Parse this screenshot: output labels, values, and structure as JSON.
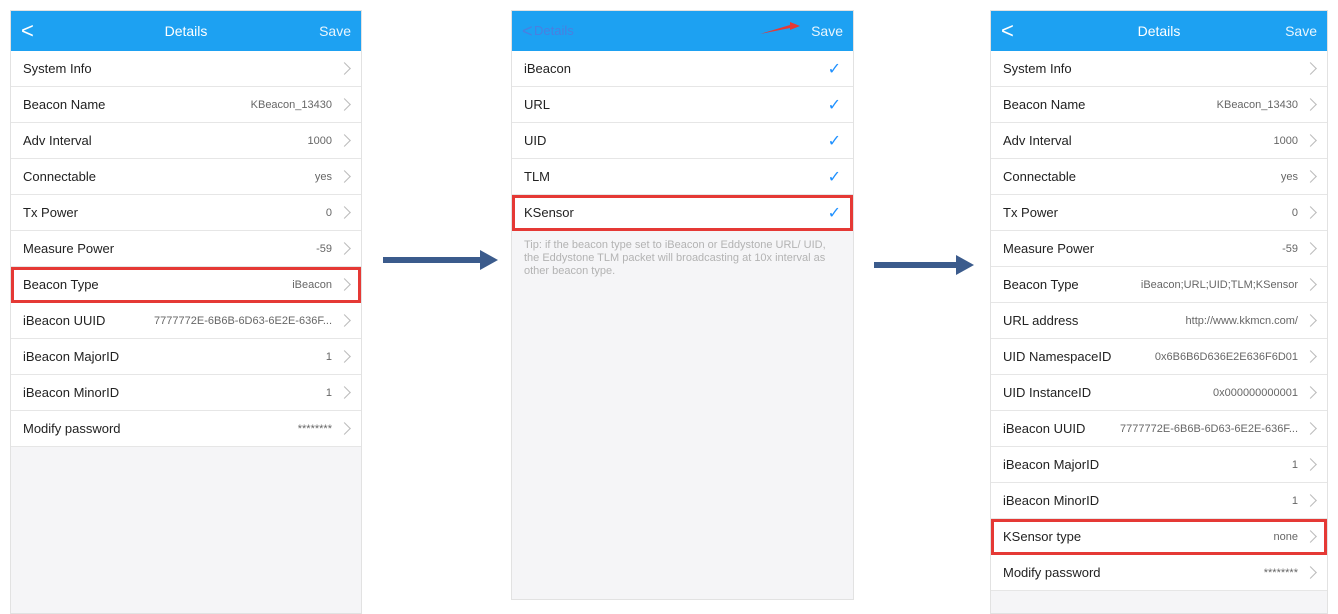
{
  "screen1": {
    "nav": {
      "back": "<",
      "title": "Details",
      "save": "Save"
    },
    "rows": [
      {
        "label": "System Info",
        "value": ""
      },
      {
        "label": "Beacon Name",
        "value": "KBeacon_13430"
      },
      {
        "label": "Adv Interval",
        "value": "1000"
      },
      {
        "label": "Connectable",
        "value": "yes"
      },
      {
        "label": "Tx Power",
        "value": "0"
      },
      {
        "label": "Measure Power",
        "value": "-59"
      },
      {
        "label": "Beacon Type",
        "value": "iBeacon"
      },
      {
        "label": "iBeacon UUID",
        "value": "7777772E-6B6B-6D63-6E2E-636F..."
      },
      {
        "label": "iBeacon MajorID",
        "value": "1"
      },
      {
        "label": "iBeacon MinorID",
        "value": "1"
      },
      {
        "label": "Modify password",
        "value": "********"
      }
    ]
  },
  "screen2": {
    "nav": {
      "back": "<",
      "title": "Details",
      "save": "Save"
    },
    "rows": [
      {
        "label": "iBeacon",
        "check": "✓"
      },
      {
        "label": "URL",
        "check": "✓"
      },
      {
        "label": "UID",
        "check": "✓"
      },
      {
        "label": "TLM",
        "check": "✓"
      },
      {
        "label": "KSensor",
        "check": "✓"
      }
    ],
    "tip": "Tip: if the beacon type set to iBeacon or Eddystone URL/ UID, the Eddystone TLM packet will broadcasting at 10x interval as other beacon type."
  },
  "screen3": {
    "nav": {
      "back": "<",
      "title": "Details",
      "save": "Save"
    },
    "rows": [
      {
        "label": "System Info",
        "value": ""
      },
      {
        "label": "Beacon Name",
        "value": "KBeacon_13430"
      },
      {
        "label": "Adv Interval",
        "value": "1000"
      },
      {
        "label": "Connectable",
        "value": "yes"
      },
      {
        "label": "Tx Power",
        "value": "0"
      },
      {
        "label": "Measure Power",
        "value": "-59"
      },
      {
        "label": "Beacon Type",
        "value": "iBeacon;URL;UID;TLM;KSensor"
      },
      {
        "label": "URL address",
        "value": "http://www.kkmcn.com/"
      },
      {
        "label": "UID NamespaceID",
        "value": "0x6B6B6D636E2E636F6D01"
      },
      {
        "label": "UID InstanceID",
        "value": "0x000000000001"
      },
      {
        "label": "iBeacon UUID",
        "value": "7777772E-6B6B-6D63-6E2E-636F..."
      },
      {
        "label": "iBeacon MajorID",
        "value": "1"
      },
      {
        "label": "iBeacon MinorID",
        "value": "1"
      },
      {
        "label": "KSensor type",
        "value": "none"
      },
      {
        "label": "Modify password",
        "value": "********"
      }
    ]
  },
  "colors": {
    "accent": "#1da1f2",
    "highlight": "#e53935",
    "arrow": "#3b5b8c"
  }
}
